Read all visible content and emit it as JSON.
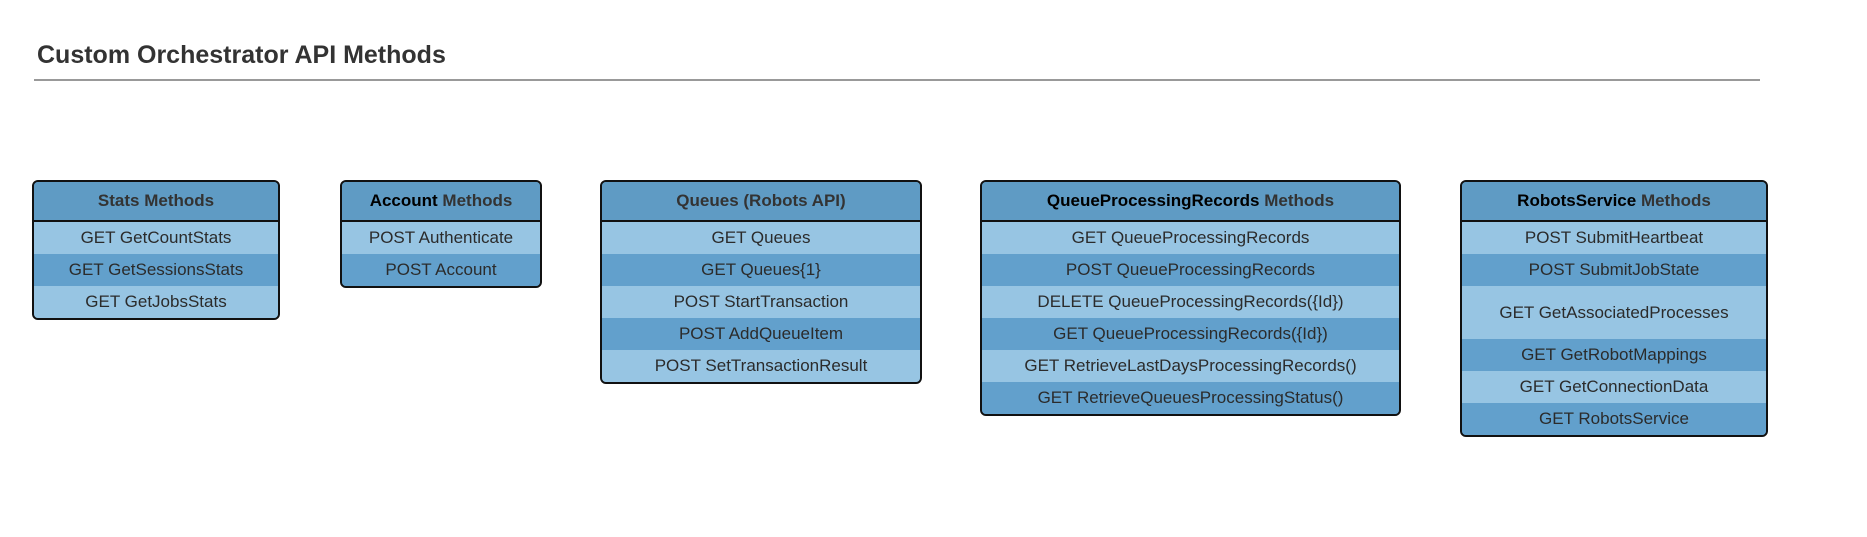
{
  "page": {
    "title": "Custom Orchestrator API Methods"
  },
  "colors": {
    "header": "#5f9bc4",
    "row_light": "#97c5e3",
    "row_dark": "#62a0cc",
    "border": "#111111",
    "title_rule": "#999999"
  },
  "boxes": [
    {
      "title_emphasis": "",
      "title_rest": "Stats Methods",
      "rows": [
        "GET GetCountStats",
        "GET GetSessionsStats",
        "GET GetJobsStats"
      ]
    },
    {
      "title_emphasis": "Account",
      "title_rest": " Methods",
      "rows": [
        "POST Authenticate",
        "POST Account"
      ]
    },
    {
      "title_emphasis": "",
      "title_rest": "Queues (Robots API)",
      "rows": [
        "GET Queues",
        "GET Queues{1}",
        "POST StartTransaction",
        "POST AddQueueItem",
        "POST SetTransactionResult"
      ]
    },
    {
      "title_emphasis": "QueueProcessingRecords",
      "title_rest": " Methods",
      "rows": [
        "GET QueueProcessingRecords",
        "POST QueueProcessingRecords",
        "DELETE QueueProcessingRecords({Id})",
        "GET QueueProcessingRecords({Id})",
        "GET RetrieveLastDaysProcessingRecords()",
        "GET RetrieveQueuesProcessingStatus()"
      ]
    },
    {
      "title_emphasis": "RobotsService",
      "title_rest": " Methods",
      "rows": [
        "POST SubmitHeartbeat",
        "POST SubmitJobState",
        "GET GetAssociatedProcesses",
        "GET GetRobotMappings",
        "GET GetConnectionData",
        "GET RobotsService"
      ]
    }
  ]
}
